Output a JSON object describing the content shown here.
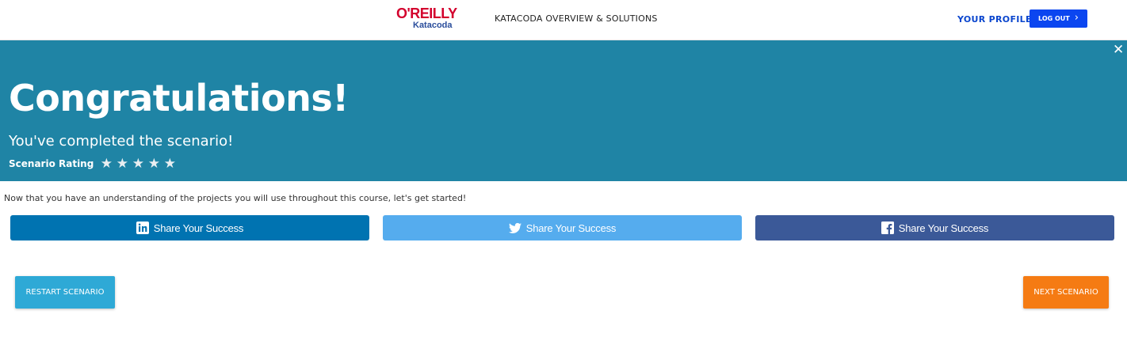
{
  "header": {
    "logo_primary": "O'REILLY",
    "logo_secondary": "Katacoda",
    "nav_overview": "KATACODA OVERVIEW & SOLUTIONS",
    "nav_profile": "YOUR PROFILE",
    "logout_label": "LOG OUT",
    "logout_icon": "chevron-right-icon"
  },
  "banner": {
    "title": "Congratulations!",
    "subtitle": "You've completed the scenario!",
    "rating_label": "Scenario Rating",
    "rating_stars_total": 5,
    "rating_value": 0,
    "close_icon": "close-icon",
    "background": "#1f84a5"
  },
  "content": {
    "intro": "Now that you have an understanding of the projects you will use throughout this course, let's get started!",
    "share_buttons": [
      {
        "network": "linkedin",
        "label": "Share Your Success",
        "color": "#0073b1",
        "icon": "linkedin-icon"
      },
      {
        "network": "twitter",
        "label": "Share Your Success",
        "color": "#55acee",
        "icon": "twitter-icon"
      },
      {
        "network": "facebook",
        "label": "Share Your Success",
        "color": "#3b5998",
        "icon": "facebook-icon"
      }
    ],
    "restart_label": "RESTART SCENARIO",
    "next_label": "NEXT SCENARIO"
  },
  "colors": {
    "logout": "#0b46f0",
    "profile_link": "#0b46ce",
    "restart": "#2ea9d6",
    "next": "#f57b13"
  }
}
